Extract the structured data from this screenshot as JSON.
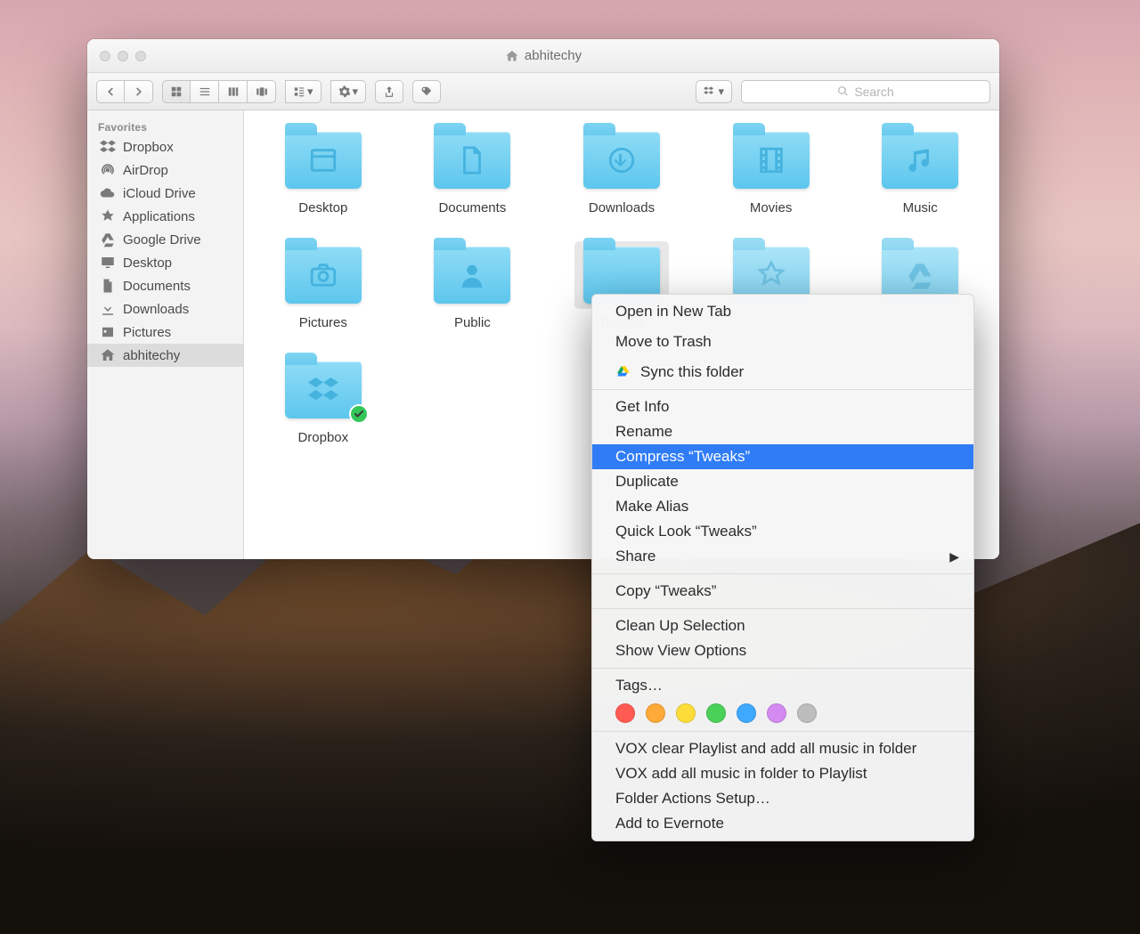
{
  "window": {
    "title": "abhitechy"
  },
  "toolbar": {
    "search_placeholder": "Search"
  },
  "sidebar": {
    "heading": "Favorites",
    "items": [
      {
        "label": "Dropbox",
        "icon": "dropbox",
        "selected": false
      },
      {
        "label": "AirDrop",
        "icon": "airdrop",
        "selected": false
      },
      {
        "label": "iCloud Drive",
        "icon": "cloud",
        "selected": false
      },
      {
        "label": "Applications",
        "icon": "apps",
        "selected": false
      },
      {
        "label": "Google Drive",
        "icon": "gdrive",
        "selected": false
      },
      {
        "label": "Desktop",
        "icon": "desktop",
        "selected": false
      },
      {
        "label": "Documents",
        "icon": "docs",
        "selected": false
      },
      {
        "label": "Downloads",
        "icon": "download",
        "selected": false
      },
      {
        "label": "Pictures",
        "icon": "pictures",
        "selected": false
      },
      {
        "label": "abhitechy",
        "icon": "home",
        "selected": true
      }
    ]
  },
  "files": {
    "items": [
      {
        "label": "Desktop",
        "icon": "window",
        "selected": false,
        "dim": false
      },
      {
        "label": "Documents",
        "icon": "doc",
        "selected": false,
        "dim": false
      },
      {
        "label": "Downloads",
        "icon": "download",
        "selected": false,
        "dim": false
      },
      {
        "label": "Movies",
        "icon": "film",
        "selected": false,
        "dim": false
      },
      {
        "label": "Music",
        "icon": "music",
        "selected": false,
        "dim": false
      },
      {
        "label": "Pictures",
        "icon": "camera",
        "selected": false,
        "dim": false
      },
      {
        "label": "Public",
        "icon": "person",
        "selected": false,
        "dim": false
      },
      {
        "label": "Tweaks",
        "icon": "",
        "selected": true,
        "dim": false
      },
      {
        "label": "",
        "icon": "appfolder",
        "selected": false,
        "dim": true
      },
      {
        "label": "",
        "icon": "gdrive",
        "selected": false,
        "dim": true
      },
      {
        "label": "Dropbox",
        "icon": "dropbox",
        "selected": false,
        "dim": false,
        "badge": true
      }
    ]
  },
  "context_menu": {
    "groups": [
      [
        {
          "label": "Open in New Tab"
        },
        {
          "label": ""
        },
        {
          "label": "Move to Trash"
        },
        {
          "label": ""
        },
        {
          "label": "Sync this folder",
          "icon": "gdrive"
        }
      ],
      [
        {
          "label": "Get Info"
        },
        {
          "label": "Rename"
        },
        {
          "label": "Compress “Tweaks”",
          "highlighted": true
        },
        {
          "label": "Duplicate"
        },
        {
          "label": "Make Alias"
        },
        {
          "label": "Quick Look “Tweaks”"
        },
        {
          "label": "Share",
          "submenu": true
        }
      ],
      [
        {
          "label": "Copy “Tweaks”"
        }
      ],
      [
        {
          "label": "Clean Up Selection"
        },
        {
          "label": "Show View Options"
        }
      ],
      [
        {
          "label": "Tags…"
        }
      ],
      [
        {
          "label": "VOX clear Playlist and add all music in folder"
        },
        {
          "label": "VOX add all music in folder to Playlist"
        },
        {
          "label": "Folder Actions Setup…"
        },
        {
          "label": "Add to Evernote"
        }
      ]
    ],
    "tag_colors": [
      "#ff5b52",
      "#fea938",
      "#fddc3a",
      "#4ad158",
      "#3fa8ff",
      "#d38af1",
      "#bdbdbd"
    ]
  }
}
